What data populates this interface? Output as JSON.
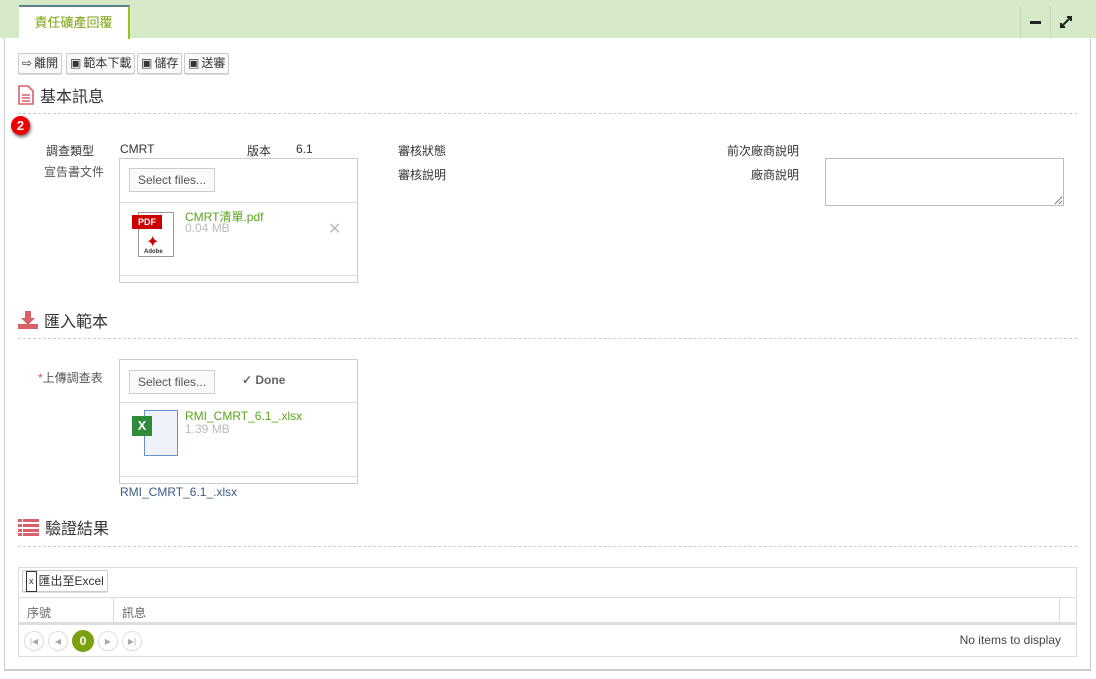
{
  "window": {
    "tab_title": "責任礦產回覆",
    "minimize_icon": "minimize-icon",
    "maximize_icon": "expand-icon"
  },
  "toolbar": {
    "leave": "離開",
    "download_template": "範本下載",
    "save": "儲存",
    "submit": "送審"
  },
  "notification_badge": "2",
  "basic_info": {
    "title": "基本訊息",
    "survey_type_label": "調查類型",
    "survey_type_value": "CMRT",
    "version_label": "版本",
    "version_value": "6.1",
    "review_status_label": "審核狀態",
    "review_note_label": "審核說明",
    "prev_vendor_note_label": "前次廠商說明",
    "vendor_note_label": "廠商說明",
    "vendor_note_value": "",
    "declaration_label": "宣告書文件",
    "select_files": "Select files...",
    "file": {
      "name": "CMRT清單.pdf",
      "size": "0.04 MB"
    }
  },
  "import_template": {
    "title": "匯入範本",
    "required_mark": "*",
    "upload_label": "上傳調查表",
    "select_files": "Select files...",
    "status": "Done",
    "file": {
      "name": "RMI_CMRT_6.1_.xlsx",
      "size": "1.39 MB"
    },
    "uploaded_link": "RMI_CMRT_6.1_.xlsx"
  },
  "validation": {
    "title": "驗證結果",
    "export_button": "匯出至Excel",
    "columns": [
      "序號",
      "訊息"
    ],
    "rows": [],
    "current_page": "0",
    "empty_text": "No items to display"
  },
  "colors": {
    "accent": "#7aa20f",
    "header_bg": "#d6e9c8",
    "section_icon": "#d9626a"
  }
}
